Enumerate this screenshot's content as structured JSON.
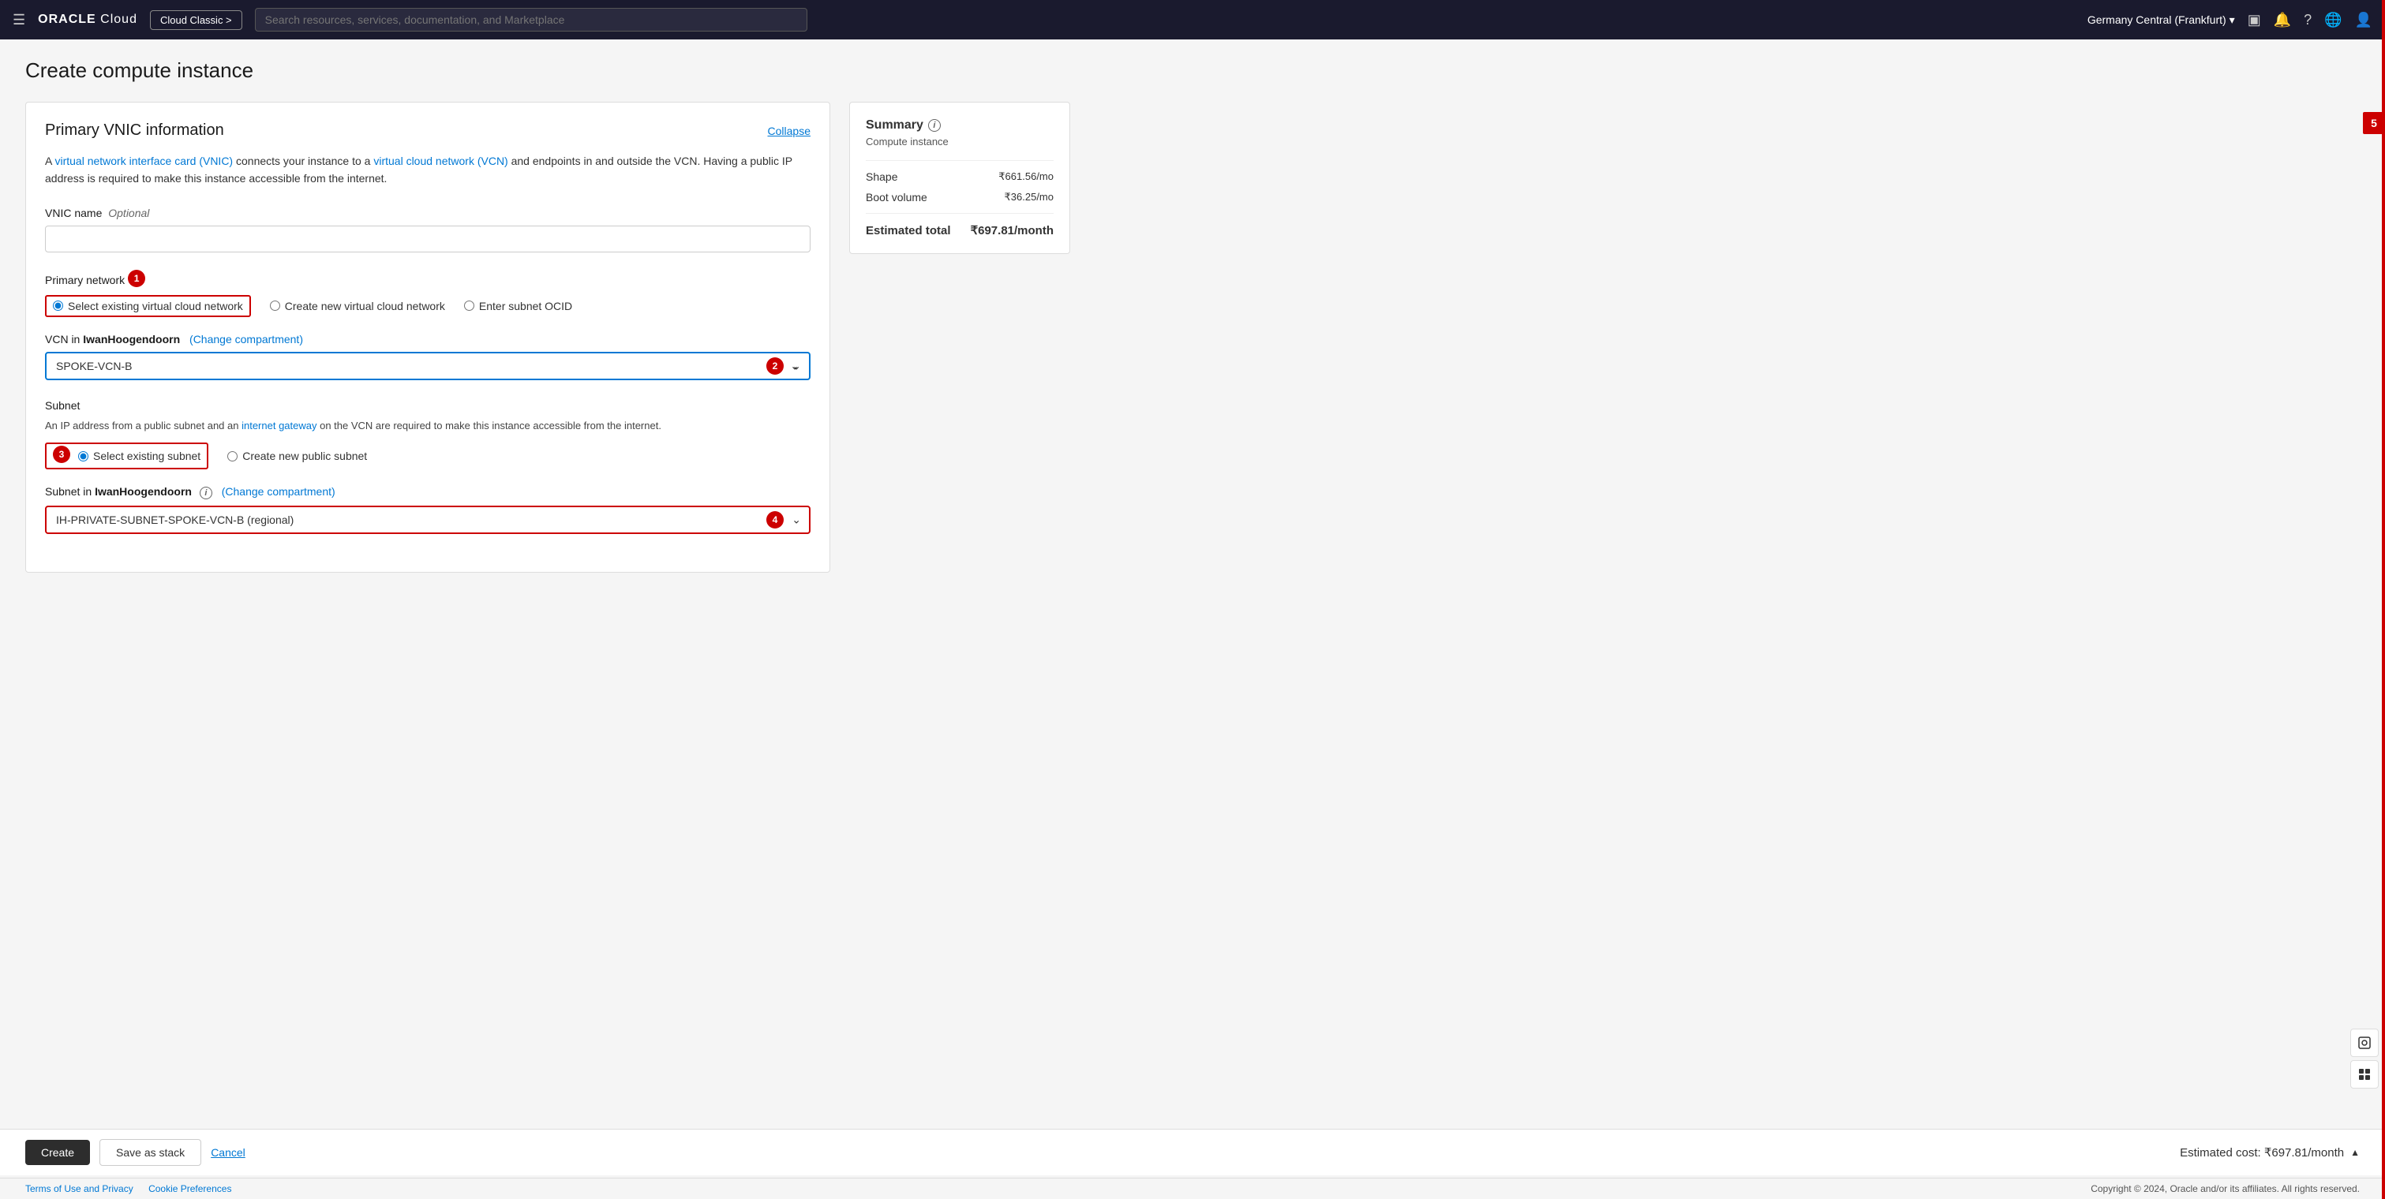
{
  "header": {
    "hamburger_label": "☰",
    "logo_oracle": "ORACLE",
    "logo_cloud": "Cloud",
    "cloud_classic_label": "Cloud Classic >",
    "search_placeholder": "Search resources, services, documentation, and Marketplace",
    "region": "Germany Central (Frankfurt)",
    "region_chevron": "▾",
    "icon_monitor": "▣",
    "icon_bell": "🔔",
    "icon_question": "?",
    "icon_globe": "🌐",
    "icon_user": "👤"
  },
  "page": {
    "title": "Create compute instance"
  },
  "card": {
    "title": "Primary VNIC information",
    "collapse_label": "Collapse",
    "description_part1": "A ",
    "vnic_link": "virtual network interface card (VNIC)",
    "description_part2": " connects your instance to a ",
    "vcn_link": "virtual cloud network (VCN)",
    "description_part3": " and endpoints in and outside the VCN. Having a public IP address is required to make this instance accessible from the internet.",
    "vnic_name_label": "VNIC name",
    "vnic_name_optional": "Optional",
    "vnic_name_value": "",
    "primary_network_label": "Primary network",
    "badge_1": "1",
    "radio_select_existing_vcn": "Select existing virtual cloud network",
    "radio_create_new_vcn": "Create new virtual cloud network",
    "radio_enter_subnet_ocid": "Enter subnet OCID",
    "vcn_compartment_label": "VCN in",
    "vcn_compartment_name": "IwanHoogendoorn",
    "change_compartment_link": "(Change compartment)",
    "vcn_value": "SPOKE-VCN-B",
    "badge_2": "2",
    "vcn_options": [
      "SPOKE-VCN-B"
    ],
    "subnet_label": "Subnet",
    "subnet_desc_part1": "An IP address from a public subnet and an ",
    "subnet_internet_gateway_link": "internet gateway",
    "subnet_desc_part2": " on the VCN are required to make this instance accessible from the internet.",
    "badge_3": "3",
    "radio_select_existing_subnet": "Select existing subnet",
    "radio_create_new_public_subnet": "Create new public subnet",
    "subnet_compartment_label": "Subnet in",
    "subnet_compartment_name": "IwanHoogendoorn",
    "subnet_info_icon": "i",
    "subnet_change_compartment_link": "(Change compartment)",
    "subnet_value": "IH-PRIVATE-SUBNET-SPOKE-VCN-B (regional)",
    "badge_4": "4",
    "subnet_options": [
      "IH-PRIVATE-SUBNET-SPOKE-VCN-B (regional)"
    ]
  },
  "summary": {
    "title": "Summary",
    "info_icon": "i",
    "subtitle": "Compute instance",
    "shape_label": "Shape",
    "shape_value": "₹661.56/mo",
    "boot_volume_label": "Boot volume",
    "boot_volume_value": "₹36.25/mo",
    "estimated_total_label": "Estimated total",
    "estimated_total_value": "₹697.81/month"
  },
  "footer": {
    "create_label": "Create",
    "save_as_stack_label": "Save as stack",
    "cancel_label": "Cancel",
    "estimated_cost_label": "Estimated cost: ₹697.81/month",
    "chevron": "▲"
  },
  "copyright": {
    "terms_label": "Terms of Use and Privacy",
    "cookie_label": "Cookie Preferences",
    "copyright_text": "Copyright © 2024, Oracle and/or its affiliates. All rights reserved."
  },
  "badges": {
    "b1": "1",
    "b2": "2",
    "b3": "3",
    "b4": "4",
    "b5": "5"
  }
}
